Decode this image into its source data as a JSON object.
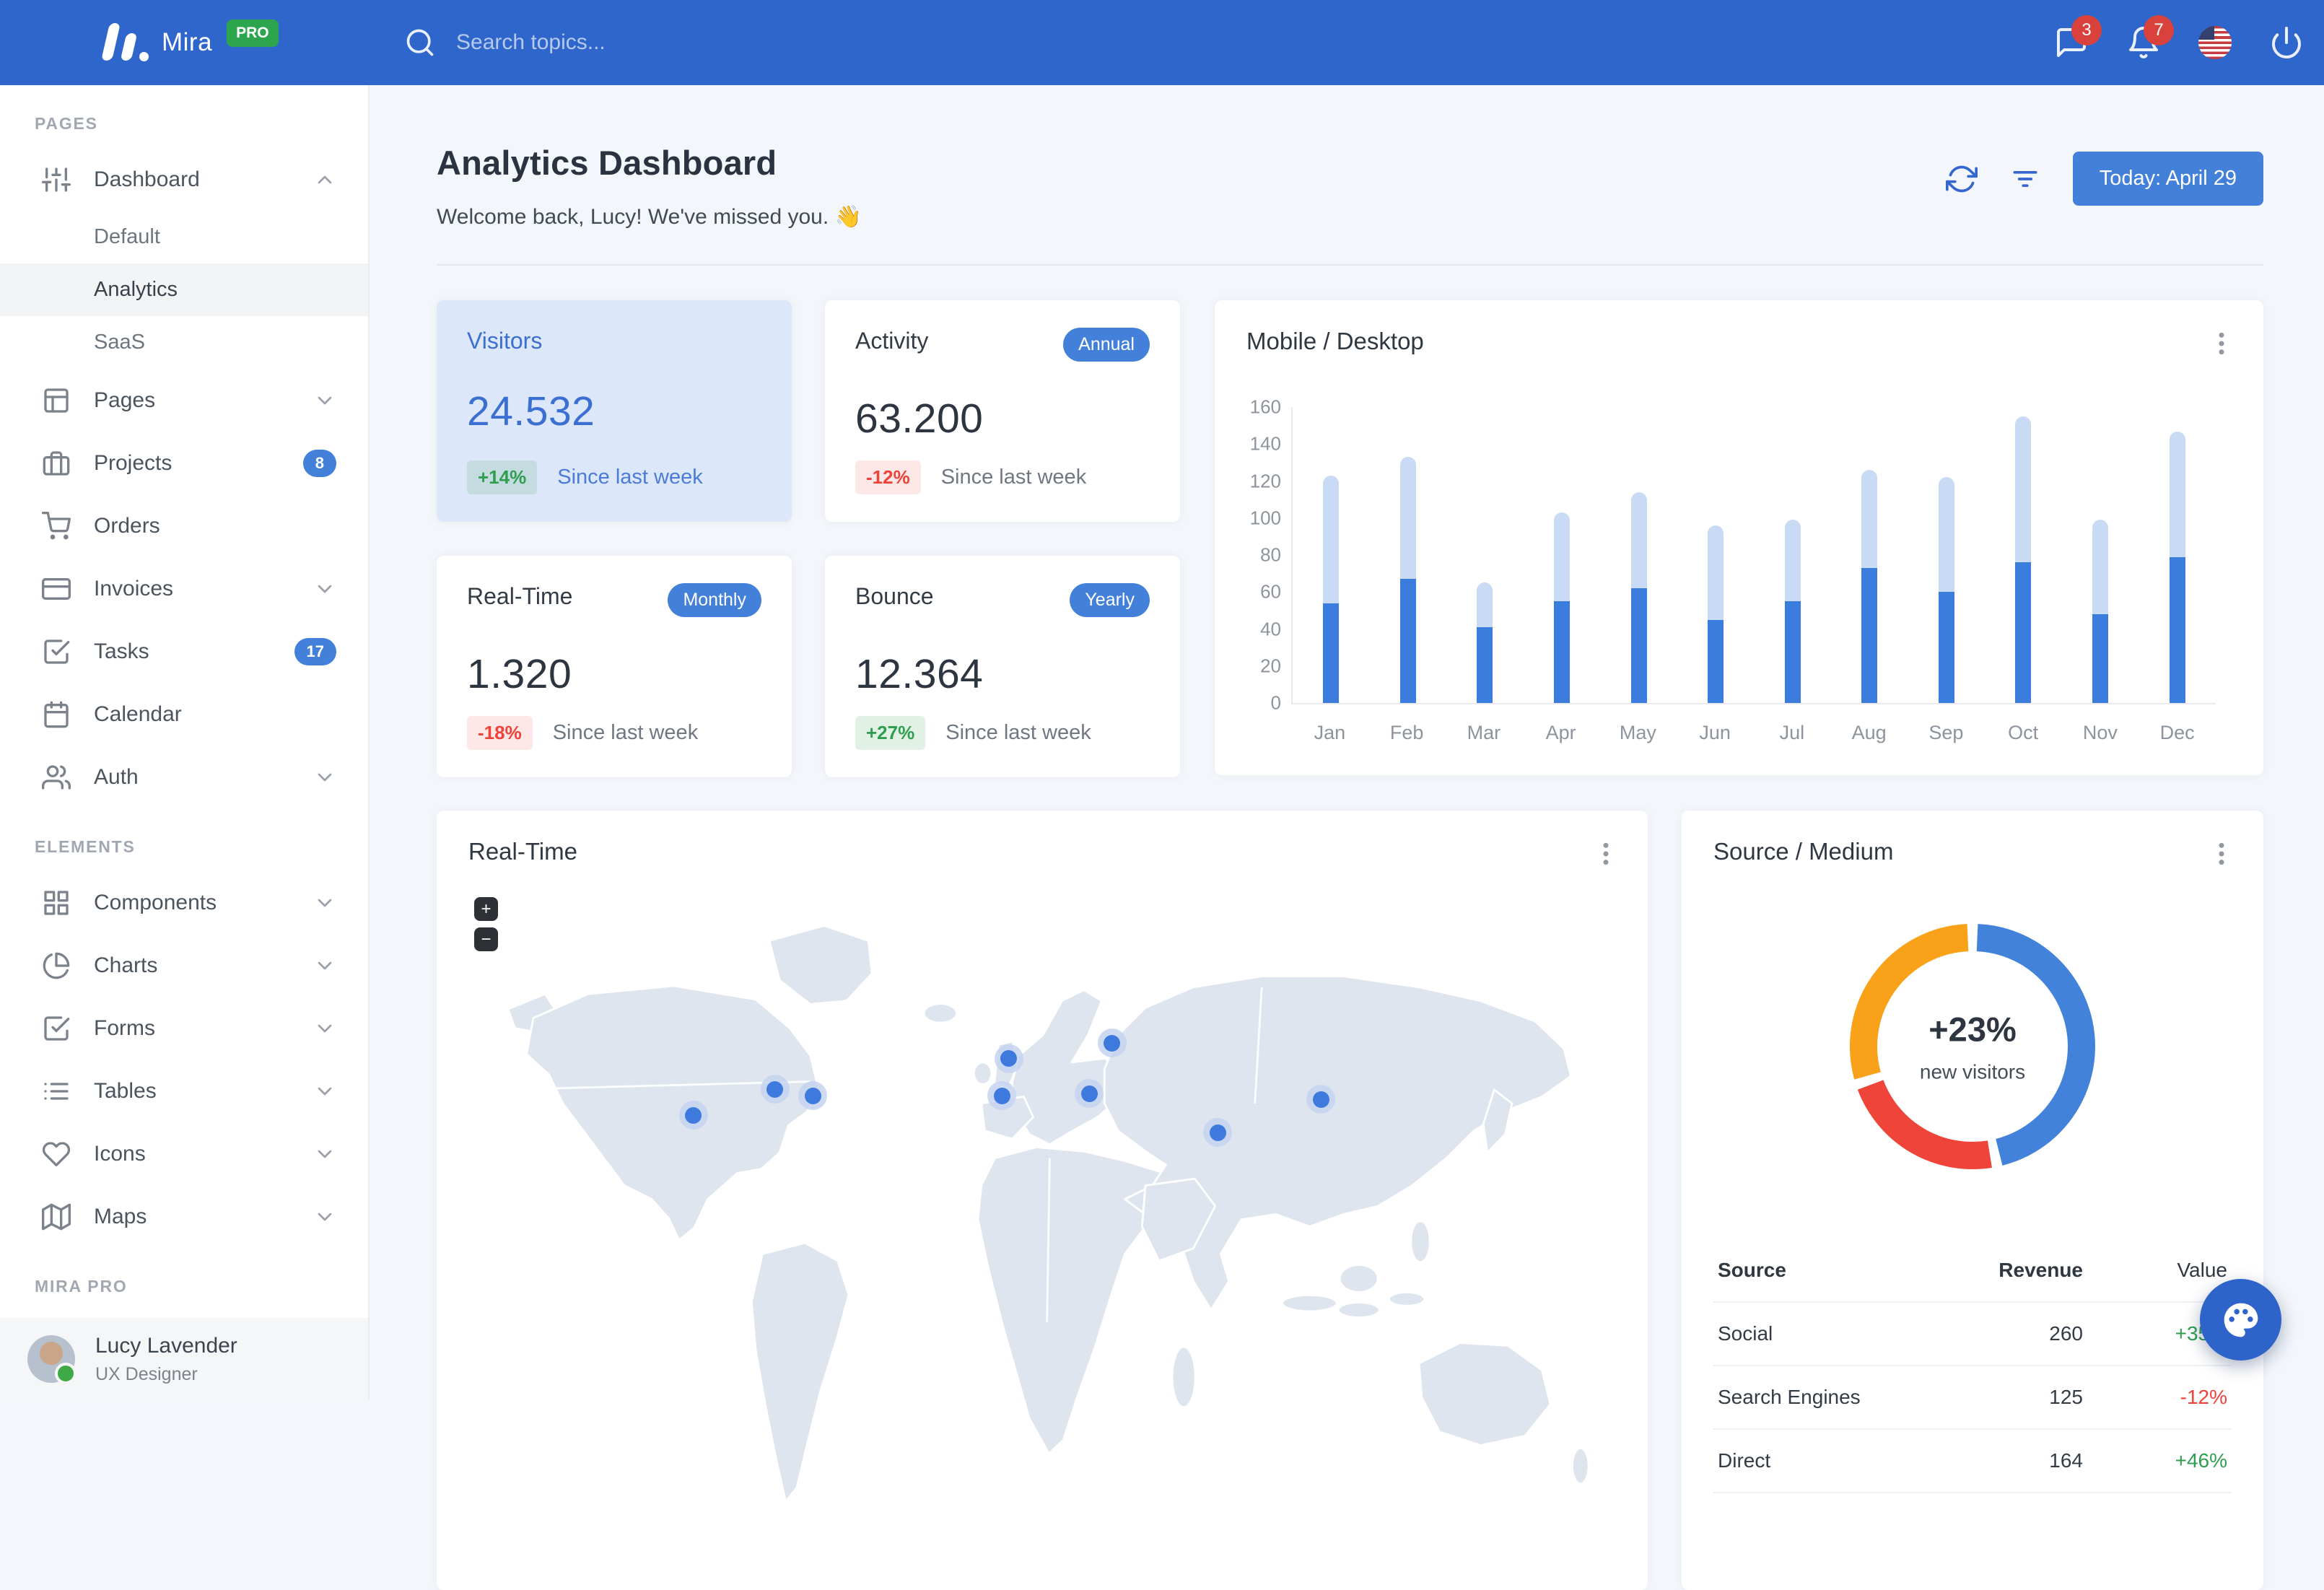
{
  "colors": {
    "navbar": "#2f66cb",
    "primary": "#3b7ddd",
    "button": "#4380d9",
    "success": "#2f9e4f",
    "danger": "#ee4338",
    "warning": "#f9a119",
    "bar_mobile": "#3b7ddd",
    "bar_desktop": "#c9daf4"
  },
  "navbar": {
    "brand": "Mira",
    "brand_badge": "PRO",
    "search_placeholder": "Search topics...",
    "messages_badge": "3",
    "alerts_badge": "7"
  },
  "sidebar": {
    "sections": [
      {
        "label": "PAGES",
        "items": [
          {
            "label": "Dashboard",
            "icon": "sliders",
            "expanded": true,
            "children": [
              {
                "label": "Default"
              },
              {
                "label": "Analytics",
                "active": true
              },
              {
                "label": "SaaS"
              }
            ]
          },
          {
            "label": "Pages",
            "icon": "layout",
            "collapsible": true
          },
          {
            "label": "Projects",
            "icon": "briefcase",
            "badge": "8"
          },
          {
            "label": "Orders",
            "icon": "cart"
          },
          {
            "label": "Invoices",
            "icon": "credit-card",
            "collapsible": true
          },
          {
            "label": "Tasks",
            "icon": "check-square",
            "badge": "17"
          },
          {
            "label": "Calendar",
            "icon": "calendar"
          },
          {
            "label": "Auth",
            "icon": "users",
            "collapsible": true
          }
        ]
      },
      {
        "label": "ELEMENTS",
        "items": [
          {
            "label": "Components",
            "icon": "grid",
            "collapsible": true
          },
          {
            "label": "Charts",
            "icon": "pie-chart",
            "collapsible": true
          },
          {
            "label": "Forms",
            "icon": "check-square",
            "collapsible": true
          },
          {
            "label": "Tables",
            "icon": "list",
            "collapsible": true
          },
          {
            "label": "Icons",
            "icon": "heart",
            "collapsible": true
          },
          {
            "label": "Maps",
            "icon": "map",
            "collapsible": true
          }
        ]
      },
      {
        "label": "MIRA PRO",
        "items": []
      }
    ],
    "user": {
      "name": "Lucy Lavender",
      "role": "UX Designer",
      "status": "online"
    }
  },
  "header": {
    "title": "Analytics Dashboard",
    "welcome": "Welcome back, Lucy! We've missed you. 👋",
    "date_button": "Today: April 29"
  },
  "stats": [
    {
      "title": "Visitors",
      "value": "24.532",
      "delta": "+14%",
      "delta_dir": "up",
      "note": "Since last week",
      "badge": null,
      "variant": "primary"
    },
    {
      "title": "Activity",
      "value": "63.200",
      "delta": "-12%",
      "delta_dir": "down",
      "note": "Since last week",
      "badge": "Annual",
      "variant": "default"
    },
    {
      "title": "Real-Time",
      "value": "1.320",
      "delta": "-18%",
      "delta_dir": "down",
      "note": "Since last week",
      "badge": "Monthly",
      "variant": "default"
    },
    {
      "title": "Bounce",
      "value": "12.364",
      "delta": "+27%",
      "delta_dir": "up",
      "note": "Since last week",
      "badge": "Yearly",
      "variant": "default"
    }
  ],
  "chart_data": [
    {
      "id": "mobile-desktop",
      "type": "bar",
      "stacked": true,
      "title": "Mobile / Desktop",
      "categories": [
        "Jan",
        "Feb",
        "Mar",
        "Apr",
        "May",
        "Jun",
        "Jul",
        "Aug",
        "Sep",
        "Oct",
        "Nov",
        "Dec"
      ],
      "series": [
        {
          "name": "Mobile",
          "color": "#3b7ddd",
          "values": [
            54,
            67,
            41,
            55,
            62,
            45,
            55,
            73,
            60,
            76,
            48,
            79
          ]
        },
        {
          "name": "Desktop",
          "color": "#c9daf4",
          "values": [
            69,
            66,
            24,
            48,
            52,
            51,
            44,
            53,
            62,
            79,
            51,
            68
          ]
        }
      ],
      "ylim": [
        0,
        160
      ],
      "ytick_step": 20,
      "grid": false,
      "legend": "none"
    },
    {
      "id": "source-medium",
      "type": "donut",
      "title": "Source / Medium",
      "center_label": "+23%",
      "center_sublabel": "new visitors",
      "slices": [
        {
          "label": "Social",
          "value": 260,
          "color": "#4382db"
        },
        {
          "label": "Search Engines",
          "value": 125,
          "color": "#ef4439"
        },
        {
          "label": "Direct",
          "value": 164,
          "color": "#f9a119"
        }
      ]
    }
  ],
  "realtime_map": {
    "title": "Real-Time",
    "zoom_in_label": "+",
    "zoom_out_label": "−",
    "markers": [
      {
        "x": 19.6,
        "y": 36.0
      },
      {
        "x": 26.7,
        "y": 32.0
      },
      {
        "x": 30.0,
        "y": 33.0
      },
      {
        "x": 47.1,
        "y": 27.3
      },
      {
        "x": 46.5,
        "y": 33.0
      },
      {
        "x": 54.1,
        "y": 32.7
      },
      {
        "x": 56.1,
        "y": 24.9
      },
      {
        "x": 65.3,
        "y": 38.7
      },
      {
        "x": 74.3,
        "y": 33.6
      }
    ]
  },
  "source_medium": {
    "title": "Source / Medium",
    "center_label": "+23%",
    "center_sublabel": "new visitors",
    "table": {
      "headers": [
        "Source",
        "Revenue",
        "Value"
      ],
      "rows": [
        {
          "source": "Social",
          "revenue": "260",
          "value": "+35%"
        },
        {
          "source": "Search Engines",
          "revenue": "125",
          "value": "-12%"
        },
        {
          "source": "Direct",
          "revenue": "164",
          "value": "+46%"
        }
      ]
    }
  }
}
